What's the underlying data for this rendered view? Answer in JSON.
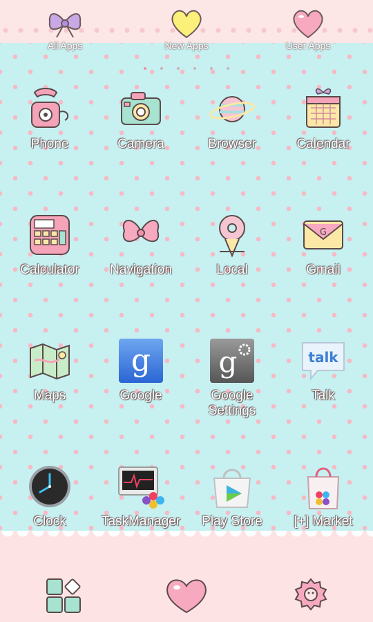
{
  "top_tabs": [
    {
      "label": "All Apps",
      "icon": "bow-icon"
    },
    {
      "label": "New Apps",
      "icon": "yellow-heart-icon"
    },
    {
      "label": "User Apps",
      "icon": "pink-heart-icon"
    }
  ],
  "page_indicator": {
    "count": 6,
    "active": 0
  },
  "apps": [
    {
      "label": "Phone",
      "icon": "phone-icon"
    },
    {
      "label": "Camera",
      "icon": "camera-icon"
    },
    {
      "label": "Browser",
      "icon": "planet-icon"
    },
    {
      "label": "Calendar",
      "icon": "calendar-icon"
    },
    {
      "label": "Calculator",
      "icon": "calculator-icon"
    },
    {
      "label": "Navigation",
      "icon": "ribbon-icon"
    },
    {
      "label": "Local",
      "icon": "donut-icon"
    },
    {
      "label": "Gmail",
      "icon": "envelope-icon"
    },
    {
      "label": "Maps",
      "icon": "map-icon"
    },
    {
      "label": "Google",
      "icon": "google-icon"
    },
    {
      "label": "Google Settings",
      "icon": "google-settings-icon"
    },
    {
      "label": "Talk",
      "icon": "talk-icon"
    },
    {
      "label": "Clock",
      "icon": "clock-icon"
    },
    {
      "label": "TaskManager",
      "icon": "taskmanager-icon"
    },
    {
      "label": "Play Store",
      "icon": "play-store-icon"
    },
    {
      "label": "[+] Market",
      "icon": "market-bag-icon"
    }
  ],
  "dock": [
    {
      "icon": "widgets-icon"
    },
    {
      "icon": "heart-home-icon"
    },
    {
      "icon": "settings-gear-icon"
    }
  ],
  "colors": {
    "background": "#c7f0f1",
    "dots": "#f7b9c4",
    "lace": "#fde3e3",
    "accent": "#f08fa7"
  }
}
